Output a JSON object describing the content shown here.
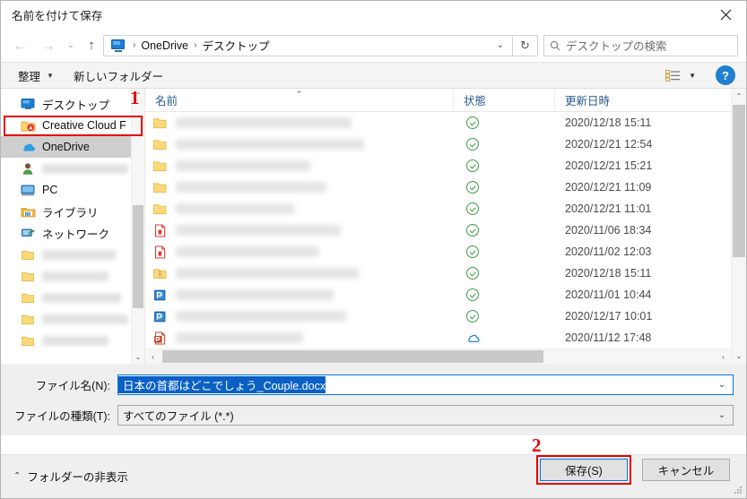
{
  "window": {
    "title": "名前を付けて保存",
    "close_label": "×"
  },
  "nav": {
    "back_icon": "arrow-left-icon",
    "forward_icon": "arrow-right-icon",
    "history_icon": "chevron-down-icon",
    "up_icon": "arrow-up-icon",
    "breadcrumb": [
      {
        "label": "OneDrive"
      },
      {
        "label": "デスクトップ"
      }
    ],
    "breadcrumb_separator": "›",
    "dropdown_icon": "chevron-down-icon",
    "refresh_icon": "refresh-icon"
  },
  "search": {
    "placeholder": "デスクトップの検索",
    "icon": "search-icon"
  },
  "toolbar": {
    "organize_label": "整理",
    "organize_caret": "▼",
    "new_folder_label": "新しいフォルダー",
    "view_icon": "list-view-icon",
    "view_caret": "▼",
    "help_label": "?"
  },
  "sidebar": {
    "items": [
      {
        "label": "デスクトップ",
        "icon": "desktop-icon",
        "selected": false,
        "blurred": false,
        "indent": true,
        "highlighted": true
      },
      {
        "label": "Creative Cloud F",
        "icon": "creative-cloud-icon",
        "selected": false,
        "blurred": false,
        "indent": true,
        "highlighted": false
      },
      {
        "label": "OneDrive",
        "icon": "onedrive-cloud-icon",
        "selected": true,
        "blurred": false,
        "indent": true,
        "highlighted": false
      },
      {
        "label": "",
        "icon": "user-icon",
        "selected": false,
        "blurred": true,
        "indent": true,
        "highlighted": false
      },
      {
        "label": "PC",
        "icon": "pc-icon",
        "selected": false,
        "blurred": false,
        "indent": true,
        "highlighted": false
      },
      {
        "label": "ライブラリ",
        "icon": "library-icon",
        "selected": false,
        "blurred": false,
        "indent": true,
        "highlighted": false
      },
      {
        "label": "ネットワーク",
        "icon": "network-icon",
        "selected": false,
        "blurred": false,
        "indent": true,
        "highlighted": false
      },
      {
        "label": "",
        "icon": "folder-icon",
        "selected": false,
        "blurred": true,
        "indent": true,
        "highlighted": false
      },
      {
        "label": "",
        "icon": "folder-icon",
        "selected": false,
        "blurred": true,
        "indent": true,
        "highlighted": false
      },
      {
        "label": "",
        "icon": "folder-icon",
        "selected": false,
        "blurred": true,
        "indent": true,
        "highlighted": false
      },
      {
        "label": "",
        "icon": "folder-icon",
        "selected": false,
        "blurred": true,
        "indent": true,
        "highlighted": false
      },
      {
        "label": "",
        "icon": "folder-icon",
        "selected": false,
        "blurred": true,
        "indent": true,
        "highlighted": false
      }
    ]
  },
  "file_list": {
    "columns": [
      {
        "label": "名前",
        "key": "name"
      },
      {
        "label": "状態",
        "key": "state"
      },
      {
        "label": "更新日時",
        "key": "date"
      }
    ],
    "sort_indicator": "⌃",
    "rows": [
      {
        "icon": "folder-icon",
        "name": "",
        "state": "synced-check-icon",
        "date": "2020/12/18 15:11",
        "name_width": 196
      },
      {
        "icon": "folder-icon",
        "name": "",
        "state": "synced-check-icon",
        "date": "2020/12/21 12:54",
        "name_width": 210
      },
      {
        "icon": "folder-icon",
        "name": "",
        "state": "synced-check-icon",
        "date": "2020/12/21 15:21",
        "name_width": 150
      },
      {
        "icon": "folder-icon",
        "name": "",
        "state": "synced-check-icon",
        "date": "2020/12/21 11:09",
        "name_width": 168
      },
      {
        "icon": "folder-icon",
        "name": "",
        "state": "synced-check-icon",
        "date": "2020/12/21 11:01",
        "name_width": 132
      },
      {
        "icon": "pdf-icon",
        "name": "",
        "state": "synced-check-icon",
        "date": "2020/11/06 18:34",
        "name_width": 184
      },
      {
        "icon": "pdf-icon",
        "name": "",
        "state": "synced-check-icon",
        "date": "2020/11/02 12:03",
        "name_width": 160
      },
      {
        "icon": "zip-folder-icon",
        "name": "",
        "state": "synced-check-icon",
        "date": "2020/12/18 15:11",
        "name_width": 204
      },
      {
        "icon": "publisher-icon",
        "name": "",
        "state": "synced-check-icon",
        "date": "2020/11/01 10:44",
        "name_width": 176
      },
      {
        "icon": "publisher-icon",
        "name": "",
        "state": "synced-check-icon",
        "date": "2020/12/17 10:01",
        "name_width": 190
      },
      {
        "icon": "powerpoint-icon",
        "name": "",
        "state": "cloud-online-icon",
        "date": "2020/11/12 17:48",
        "name_width": 142
      }
    ]
  },
  "form": {
    "filename_label": "ファイル名(N):",
    "filename_value": "日本の首都はどこでしょう_Couple.docx",
    "filetype_label": "ファイルの種類(T):",
    "filetype_value": "すべてのファイル (*.*)",
    "dropdown_icon": "chevron-down-icon"
  },
  "footer": {
    "hide_folders_caret": "⌃",
    "hide_folders_label": "フォルダーの非表示",
    "save_label": "保存(S)",
    "cancel_label": "キャンセル"
  },
  "annotations": [
    {
      "number": "1",
      "target": "sidebar-item-desktop"
    },
    {
      "number": "2",
      "target": "save-button"
    }
  ],
  "colors": {
    "accent": "#0078d7",
    "annotation": "#e60000",
    "selection": "#0a60c4",
    "sync_green": "#3d9c42",
    "column_header": "#2c5c8f"
  }
}
